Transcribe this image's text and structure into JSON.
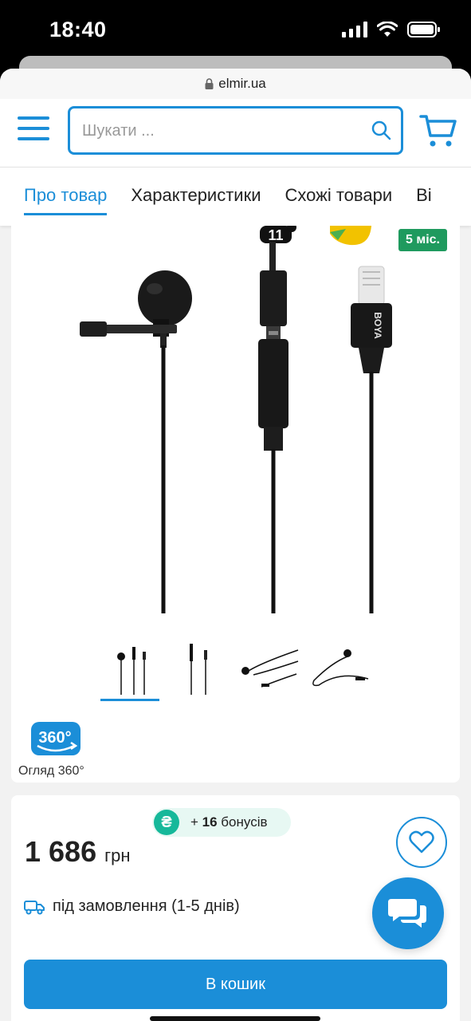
{
  "status_bar": {
    "time": "18:40"
  },
  "browser": {
    "url": "elmir.ua"
  },
  "header": {
    "search_placeholder": "Шукати ..."
  },
  "tabs": [
    {
      "label": "Про товар",
      "active": true
    },
    {
      "label": "Характеристики",
      "active": false
    },
    {
      "label": "Схожі товари",
      "active": false
    },
    {
      "label": "Ві",
      "active": false
    }
  ],
  "gallery": {
    "warranty_badge": "5 міс.",
    "promo_badge": "11",
    "brand_text": "BOYA",
    "view360_label": "Огляд 360°",
    "view360_icon_text": "360°",
    "thumbnail_count": 4,
    "active_thumbnail": 1
  },
  "price_card": {
    "bonus_icon": "₴",
    "bonus_prefix": "+ ",
    "bonus_amount": "16",
    "bonus_suffix": " бонусів",
    "price": "1 686",
    "currency": "грн",
    "delivery": "під замовлення (1-5 днів)",
    "buy_button": "В кошик"
  },
  "colors": {
    "accent": "#1b8ed8",
    "bonus": "#16b89a",
    "warranty": "#1f9a5e"
  },
  "icons": [
    "menu-icon",
    "search-icon",
    "cart-icon",
    "heart-icon",
    "truck-icon",
    "chat-icon",
    "360-icon",
    "lock-icon"
  ]
}
